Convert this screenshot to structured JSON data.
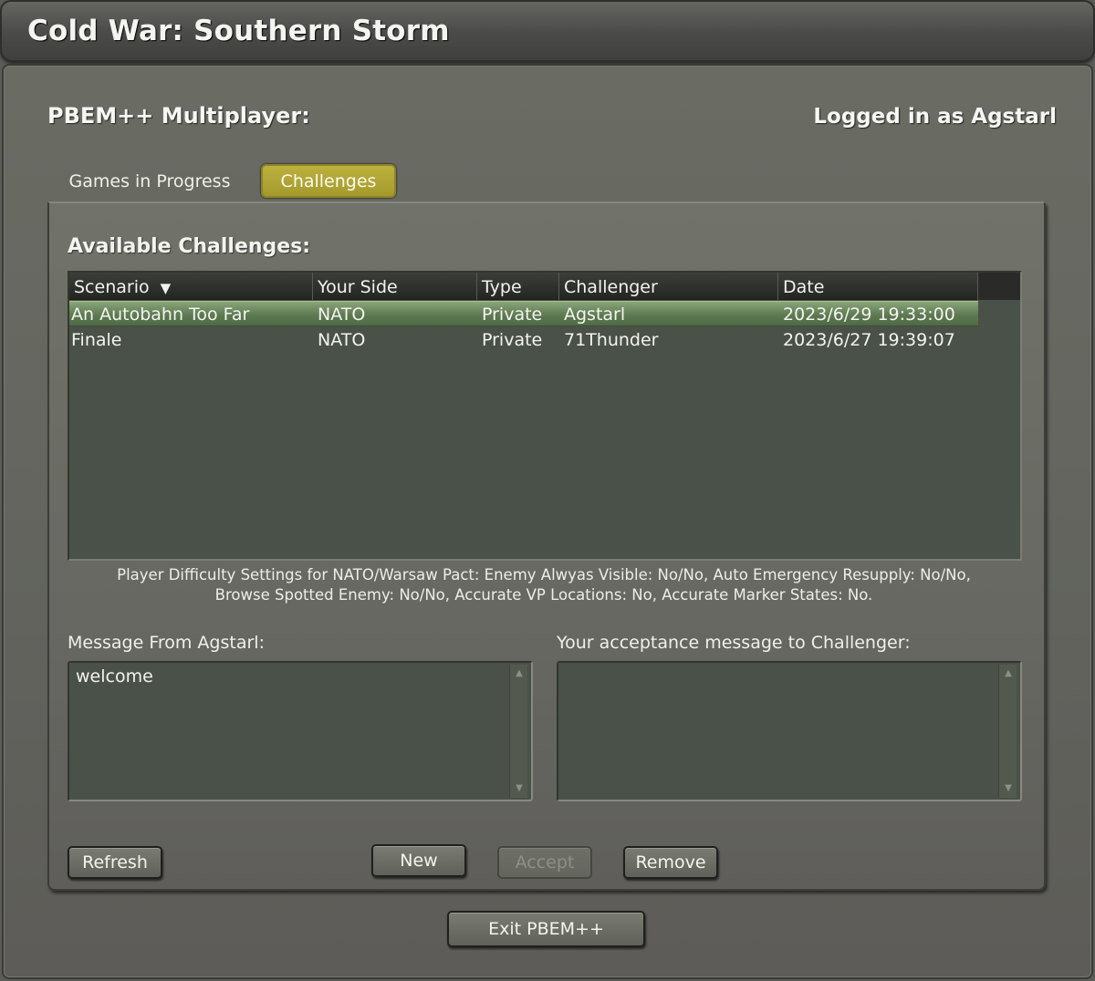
{
  "app": {
    "title": "Cold War: Southern Storm"
  },
  "header": {
    "heading": "PBEM++ Multiplayer:",
    "login": "Logged in as Agstarl"
  },
  "tabs": [
    {
      "label": "Games in Progress",
      "active": false
    },
    {
      "label": "Challenges",
      "active": true
    }
  ],
  "challenges": {
    "heading": "Available Challenges:",
    "columns": [
      "Scenario",
      "Your Side",
      "Type",
      "Challenger",
      "Date"
    ],
    "sort_indicator": "▼",
    "rows": [
      {
        "scenario": "An Autobahn Too Far",
        "side": "NATO",
        "type": "Private",
        "challenger": "Agstarl",
        "date": "2023/6/29 19:33:00",
        "selected": true
      },
      {
        "scenario": "Finale",
        "side": "NATO",
        "type": "Private",
        "challenger": "71Thunder",
        "date": "2023/6/27 19:39:07",
        "selected": false
      }
    ],
    "difficulty_text": "Player Difficulty Settings for NATO/Warsaw Pact: Enemy Alwyas Visible: No/No, Auto Emergency Resupply: No/No, Browse Spotted Enemy: No/No, Accurate VP Locations: No, Accurate Marker States: No."
  },
  "messages": {
    "from_label": "Message From Agstarl:",
    "from_text": "welcome",
    "reply_label": "Your acceptance message to Challenger:",
    "reply_text": ""
  },
  "buttons": {
    "refresh": "Refresh",
    "new": "New",
    "accept": "Accept",
    "remove": "Remove",
    "exit": "Exit PBEM++"
  },
  "colors": {
    "active_tab": "#b0a536",
    "selected_row": "#6f8c62"
  }
}
